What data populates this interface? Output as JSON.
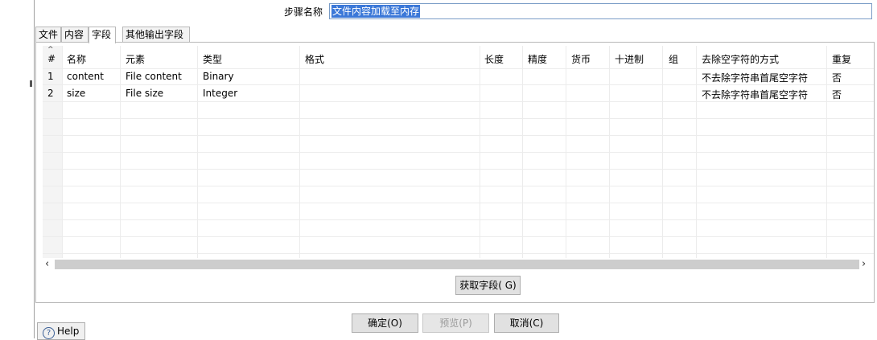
{
  "step": {
    "label": "步骤名称",
    "value": "文件内容加载至内存"
  },
  "tabs": [
    {
      "label": "文件"
    },
    {
      "label": "内容"
    },
    {
      "label": "字段"
    },
    {
      "label": "其他输出字段"
    }
  ],
  "grid": {
    "headers": {
      "index": "#",
      "name": "名称",
      "element": "元素",
      "type": "类型",
      "format": "格式",
      "length": "长度",
      "precision": "精度",
      "currency": "货币",
      "decimal": "十进制",
      "group": "组",
      "trim_type": "去除空字符的方式",
      "repeat": "重复"
    },
    "rows": [
      {
        "index": "1",
        "name": "content",
        "element": "File content",
        "type": "Binary",
        "trim_type": "不去除字符串首尾空字符",
        "repeat": "否"
      },
      {
        "index": "2",
        "name": "size",
        "element": "File size",
        "type": "Integer",
        "trim_type": "不去除字符串首尾空字符",
        "repeat": "否"
      }
    ]
  },
  "buttons": {
    "get_fields": "获取字段( G)",
    "ok": "确定(O)",
    "preview": "预览(P)",
    "cancel": "取消(C)",
    "help": "Help"
  },
  "icons": {
    "scroll_left": "‹",
    "scroll_right": "›",
    "sort": "^",
    "help": "?"
  }
}
